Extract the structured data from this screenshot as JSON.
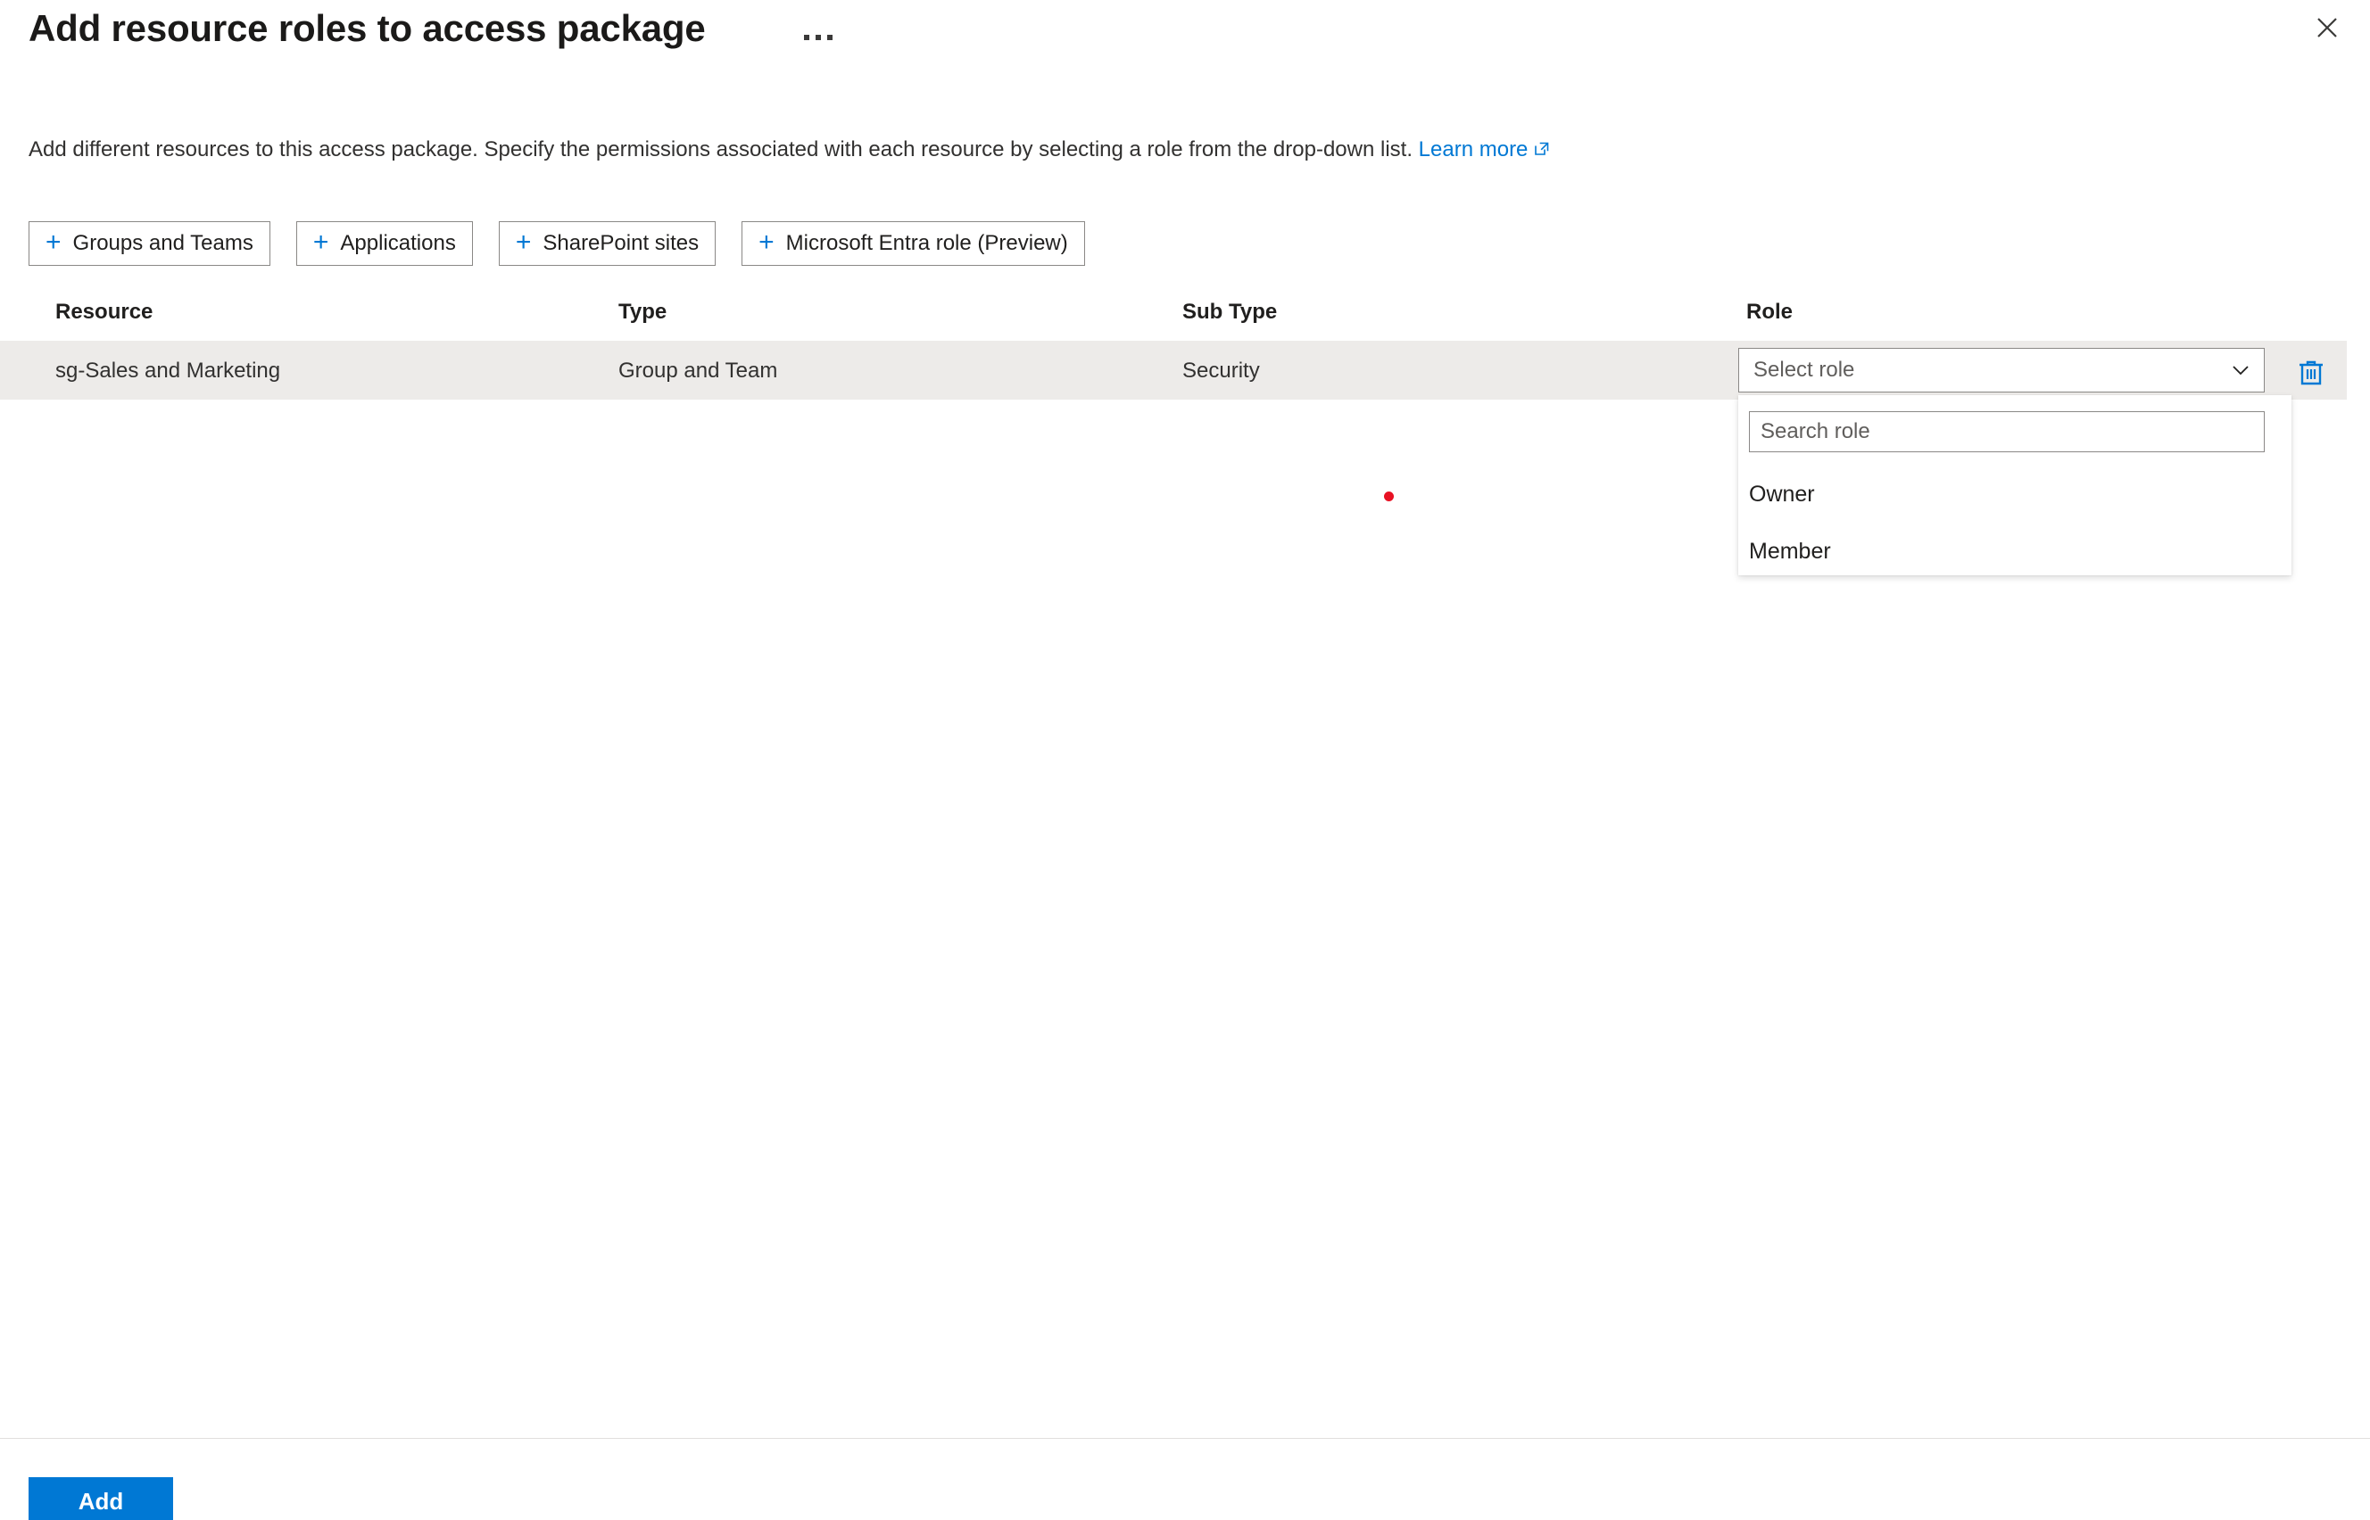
{
  "header": {
    "title": "Add resource roles to access package",
    "more_menu": "...",
    "close_label": "Close"
  },
  "description": {
    "text": "Add different resources to this access package. Specify the permissions associated with each resource by selecting a role from the drop-down list.",
    "link_label": "Learn more"
  },
  "action_bar": {
    "buttons": [
      {
        "label": "Groups and Teams",
        "icon": "plus-icon"
      },
      {
        "label": "Applications",
        "icon": "plus-icon"
      },
      {
        "label": "SharePoint sites",
        "icon": "plus-icon"
      },
      {
        "label": "Microsoft Entra role (Preview)",
        "icon": "plus-icon"
      }
    ]
  },
  "table": {
    "columns": [
      "Resource",
      "Type",
      "Sub Type",
      "Role"
    ],
    "rows": [
      {
        "resource": "sg-Sales and Marketing",
        "type": "Group and Team",
        "sub_type": "Security",
        "role_placeholder": "Select role"
      }
    ]
  },
  "role_dropdown": {
    "open": true,
    "search_placeholder": "Search role",
    "search_value": "",
    "options": [
      "Owner",
      "Member"
    ]
  },
  "footer": {
    "add_label": "Add"
  },
  "colors": {
    "accent": "#0078d4",
    "row_background": "#edebe9",
    "border": "#8a8886",
    "text": "#201f1e",
    "cursor_marker": "#e81123"
  }
}
